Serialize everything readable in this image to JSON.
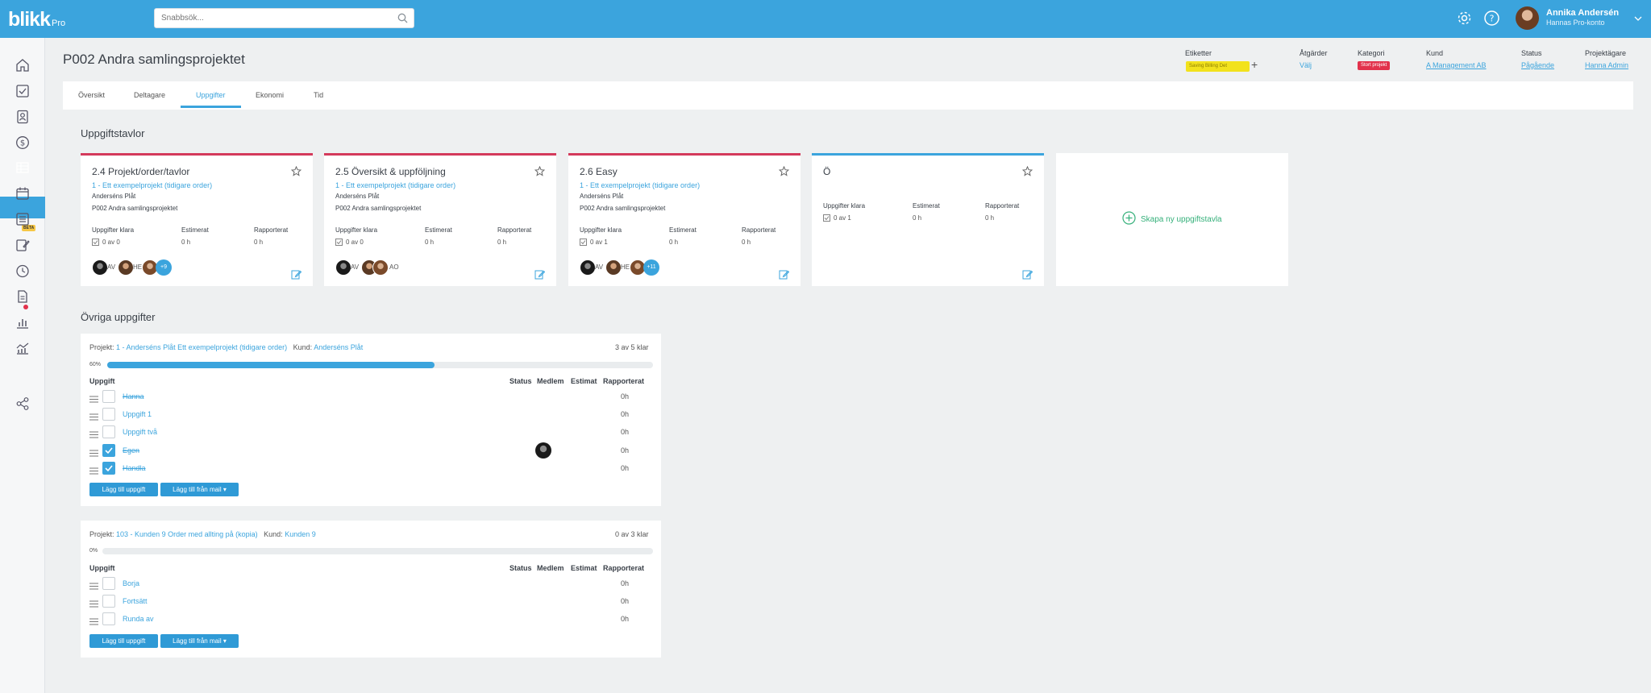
{
  "app": {
    "logo": "blikk",
    "logo_suffix": "Pro"
  },
  "search": {
    "placeholder": "Snabbsök..."
  },
  "user": {
    "name": "Annika Andersén",
    "subtitle": "Hannas Pro-konto"
  },
  "sidebar": {
    "beta_badge": "BETA"
  },
  "project": {
    "title": "P002 Andra samlingsprojektet"
  },
  "header": {
    "etiketter_label": "Etiketter",
    "etiketter_tag": "Saving Billing Det",
    "atgarder_label": "Åtgärder",
    "atgarder_value": "Välj",
    "kategori_label": "Kategori",
    "kategori_value": "Stort projekt",
    "kund_label": "Kund",
    "kund_value": "A Management AB",
    "status_label": "Status",
    "status_value": "Pågående",
    "agare_label": "Projektägare",
    "agare_value": "Hanna Admin"
  },
  "tabs": [
    "Översikt",
    "Deltagare",
    "Uppgifter",
    "Ekonomi",
    "Tid"
  ],
  "boards_title": "Uppgiftstavlor",
  "boards": [
    {
      "title": "2.4 Projekt/order/tavlor",
      "project": "1 - Ett exempelprojekt (tidigare order)",
      "customer": "Anderséns Plåt",
      "name": "P002 Andra samlingsprojektet",
      "stats": {
        "done_label": "Uppgifter klara",
        "done": "0 av 0",
        "est_label": "Estimerat",
        "est": "0 h",
        "rep_label": "Rapporterat",
        "rep": "0 h"
      },
      "members": {
        "initials1": "AV",
        "initials2": "HE",
        "more": "+9"
      }
    },
    {
      "title": "2.5 Översikt & uppföljning",
      "project": "1 - Ett exempelprojekt (tidigare order)",
      "customer": "Anderséns Plåt",
      "name": "P002 Andra samlingsprojektet",
      "stats": {
        "done_label": "Uppgifter klara",
        "done": "0 av 0",
        "est_label": "Estimerat",
        "est": "0 h",
        "rep_label": "Rapporterat",
        "rep": "0 h"
      },
      "members": {
        "initials1": "AV",
        "initials2": "AO"
      }
    },
    {
      "title": "2.6 Easy",
      "project": "1 - Ett exempelprojekt (tidigare order)",
      "customer": "Anderséns Plåt",
      "name": "P002 Andra samlingsprojektet",
      "stats": {
        "done_label": "Uppgifter klara",
        "done": "0 av 1",
        "est_label": "Estimerat",
        "est": "0 h",
        "rep_label": "Rapporterat",
        "rep": "0 h"
      },
      "members": {
        "initials1": "AV",
        "initials2": "HE",
        "more": "+11"
      }
    },
    {
      "title": "Ö",
      "stats": {
        "done_label": "Uppgifter klara",
        "done": "0 av 1",
        "est_label": "Estimerat",
        "est": "0 h",
        "rep_label": "Rapporterat",
        "rep": "0 h"
      }
    }
  ],
  "create_board": "Skapa ny uppgiftstavla",
  "other_title": "Övriga uppgifter",
  "panels": [
    {
      "project_label": "Projekt:",
      "project_link": "1 - Anderséns Plåt Ett exempelprojekt (tidigare order)",
      "customer_label": "Kund:",
      "customer_link": "Anderséns Plåt",
      "count": "3 av 5 klar",
      "percent_label": "60%",
      "progress": 0.6,
      "cols": {
        "task": "Uppgift",
        "status": "Status",
        "member": "Medlem",
        "est": "Estimat",
        "rep": "Rapporterat"
      },
      "tasks": [
        {
          "name": "Hanna",
          "rep": "0h"
        },
        {
          "name": "Uppgift 1",
          "rep": "0h"
        },
        {
          "name": "Uppgift två",
          "rep": "0h"
        },
        {
          "name": "Egen",
          "rep": "0h"
        },
        {
          "name": "Handla",
          "rep": "0h"
        }
      ],
      "add_task": "Lägg till uppgift",
      "add_mail": "Lägg till från mail ▾"
    },
    {
      "project_label": "Projekt:",
      "project_link": "103 - Kunden 9 Order med allting på (kopia)",
      "customer_label": "Kund:",
      "customer_link": "Kunden 9",
      "count": "0 av 3 klar",
      "percent_label": "0%",
      "progress": 0.0,
      "cols": {
        "task": "Uppgift",
        "status": "Status",
        "member": "Medlem",
        "est": "Estimat",
        "rep": "Rapporterat"
      },
      "tasks": [
        {
          "name": "Borja",
          "rep": "0h"
        },
        {
          "name": "Fortsätt",
          "rep": "0h"
        },
        {
          "name": "Runda av",
          "rep": "0h"
        }
      ],
      "add_task": "Lägg till uppgift",
      "add_mail": "Lägg till från mail ▾"
    }
  ]
}
